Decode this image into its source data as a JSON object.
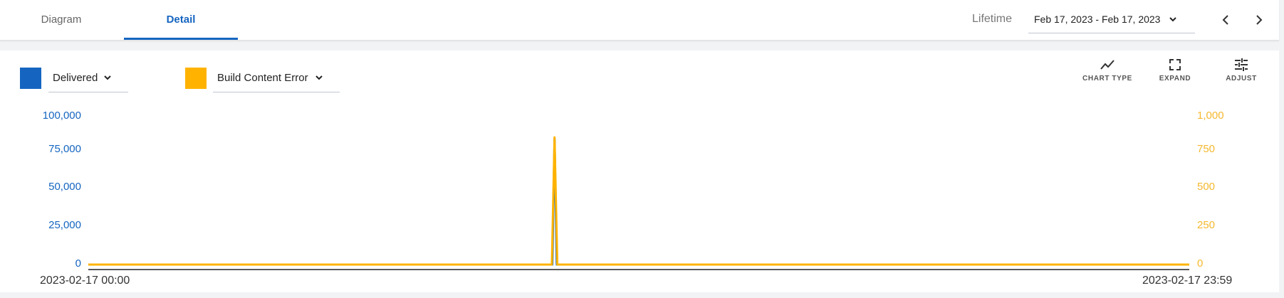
{
  "tabs": [
    {
      "label": "Diagram",
      "active": false
    },
    {
      "label": "Detail",
      "active": true
    }
  ],
  "header": {
    "lifetime_label": "Lifetime",
    "date_range": "Feb 17, 2023 - Feb 17, 2023"
  },
  "legend": {
    "delivered": {
      "label": "Delivered",
      "color": "#1565c0"
    },
    "build_error": {
      "label": "Build Content Error",
      "color": "#ffb300"
    }
  },
  "toolbar": {
    "chart_type": "CHART TYPE",
    "expand": "EXPAND",
    "adjust": "ADJUST"
  },
  "chart_data": {
    "type": "line",
    "x_start_label": "2023-02-17 00:00",
    "x_end_label": "2023-02-17 23:59",
    "y_left": {
      "ticks": [
        "100,000",
        "75,000",
        "50,000",
        "25,000",
        "0"
      ],
      "ylim": [
        0,
        100000
      ],
      "color": "#1565c0"
    },
    "y_right": {
      "ticks": [
        "1,000",
        "750",
        "500",
        "250",
        "0"
      ],
      "ylim": [
        0,
        1000
      ],
      "color": "#f5b82e"
    },
    "series": [
      {
        "name": "Delivered",
        "axis": "left",
        "color": "#1565c0",
        "points": [
          [
            0,
            0
          ],
          [
            0.4215,
            0
          ],
          [
            0.4235,
            85000
          ],
          [
            0.4255,
            0
          ],
          [
            1,
            0
          ]
        ]
      },
      {
        "name": "Build Content Error",
        "axis": "right",
        "color": "#ffb300",
        "points": [
          [
            0,
            0
          ],
          [
            0.421,
            0
          ],
          [
            0.4235,
            860
          ],
          [
            0.426,
            0
          ],
          [
            1,
            0
          ]
        ]
      }
    ],
    "grid": false
  }
}
